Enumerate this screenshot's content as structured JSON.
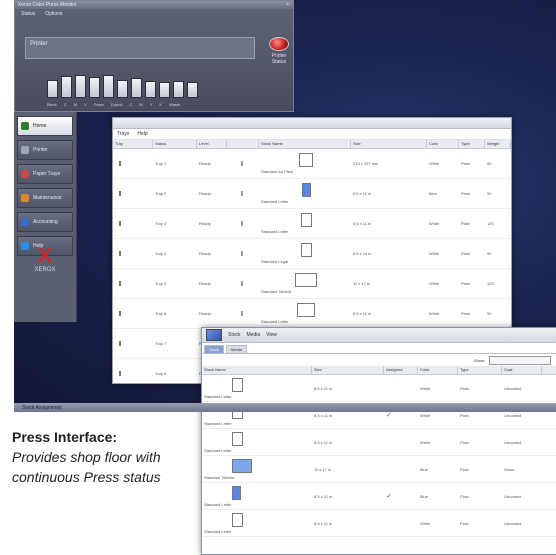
{
  "caption": {
    "title": "Press Interface:",
    "body": "Provides shop floor with continuous Press status"
  },
  "panel": {
    "title": "Xerox Color Press Monitor",
    "menu": [
      "Status",
      "Options"
    ],
    "press_name": "Printer",
    "status": "Printer Status",
    "meter_labels": [
      "Black",
      "C",
      "M",
      "Y",
      "Fuser",
      "DryInk",
      "C",
      "M",
      "Y",
      "K",
      "Waste"
    ],
    "meter_levels": [
      0.55,
      0.85,
      0.9,
      0.8,
      0.95,
      0.6,
      0.7,
      0.5,
      0.45,
      0.5,
      0.4
    ]
  },
  "nav": {
    "items": [
      {
        "label": "Home",
        "icon": "home-icon",
        "color": "#2e7d32"
      },
      {
        "label": "Printer",
        "icon": "printer-icon",
        "color": "#9aa3b8"
      },
      {
        "label": "Paper Trays",
        "icon": "paper-icon",
        "color": "#c84a4a"
      },
      {
        "label": "Maintenance",
        "icon": "wrench-icon",
        "color": "#d88a2a"
      },
      {
        "label": "Accounting",
        "icon": "chart-icon",
        "color": "#3a6bc9"
      },
      {
        "label": "Help",
        "icon": "help-icon",
        "color": "#2a8fd9"
      }
    ],
    "brand": "XEROX"
  },
  "trays_window": {
    "menu": [
      "Trays",
      "Help"
    ],
    "columns": [
      "Tray",
      "Status",
      "Level",
      "",
      "Stock Name",
      "Size",
      "Color",
      "Type",
      "Weight"
    ],
    "rows": [
      {
        "tray": "Tray 1",
        "status": "Ready",
        "level": 0.3,
        "stock": "Standard A4 Plain",
        "size": "210 x 297 mm",
        "color": "White",
        "type": "Plain",
        "weight": "90",
        "sheet_w": 12,
        "sheet_color": "#ffffff"
      },
      {
        "tray": "Tray 2",
        "status": "Ready",
        "level": 0.55,
        "stock": "Standard Letter",
        "size": "8.5 x 11 in",
        "color": "Blue",
        "type": "Plain",
        "weight": "90",
        "sheet_w": 7,
        "sheet_color": "#5b86e0"
      },
      {
        "tray": "Tray 3",
        "status": "Ready",
        "level": 0.4,
        "stock": "Standard Letter",
        "size": "8.5 x 11 in",
        "color": "White",
        "type": "Plain",
        "weight": "120",
        "sheet_w": 9,
        "sheet_color": "#ffffff"
      },
      {
        "tray": "Tray 4",
        "status": "Ready",
        "level": 0.6,
        "stock": "Standard Legal",
        "size": "8.5 x 14 in",
        "color": "White",
        "type": "Plain",
        "weight": "90",
        "sheet_w": 9,
        "sheet_color": "#ffffff"
      },
      {
        "tray": "Tray 5",
        "status": "Ready",
        "level": 0.8,
        "stock": "Standard Tabloid",
        "size": "11 x 17 in",
        "color": "White",
        "type": "Plain",
        "weight": "120",
        "sheet_w": 20,
        "sheet_color": "#ffffff"
      },
      {
        "tray": "Tray 6",
        "status": "Ready",
        "level": 0.25,
        "stock": "Standard Letter",
        "size": "8.5 x 11 in",
        "color": "White",
        "type": "Plain",
        "weight": "90",
        "sheet_w": 16,
        "sheet_color": "#ffffff"
      },
      {
        "tray": "Tray 7",
        "status": "Ready",
        "level": 0.7,
        "stock": "Standard Letter",
        "size": "8.5 x 11 in",
        "color": "Goldenrod",
        "type": "Plain",
        "weight": "90",
        "sheet_w": 8,
        "sheet_color": "#e8c82a"
      },
      {
        "tray": "Tray 8",
        "status": "Ready",
        "level": 0.45,
        "stock": "Standard Letter",
        "size": "8.5 x 11 in",
        "color": "White",
        "type": "Plain",
        "weight": "90",
        "sheet_w": 10,
        "sheet_color": "#ffffff"
      }
    ]
  },
  "stock_window": {
    "menu": [
      "Stock",
      "Media",
      "View"
    ],
    "tabs": [
      "Stock",
      "Media"
    ],
    "filter_label": "Show:",
    "columns": [
      "Stock Name",
      "Size",
      "Assigned",
      "Color",
      "Type",
      "Coat"
    ],
    "rows": [
      {
        "name": "Standard Letter",
        "size": "8.5 x 11 in",
        "assigned": "",
        "color": "White",
        "type": "Plain",
        "coat": "Uncoated",
        "sheet_w": 9,
        "sheet_color": "#ffffff"
      },
      {
        "name": "Standard Letter",
        "size": "8.5 x 11 in",
        "assigned": "✓",
        "color": "White",
        "type": "Plain",
        "coat": "Uncoated",
        "sheet_w": 9,
        "sheet_color": "#ffffff"
      },
      {
        "name": "Standard Letter",
        "size": "8.5 x 11 in",
        "assigned": "",
        "color": "White",
        "type": "Plain",
        "coat": "Uncoated",
        "sheet_w": 9,
        "sheet_color": "#ffffff"
      },
      {
        "name": "Standard Tabloid",
        "size": "11 x 17 in",
        "assigned": "",
        "color": "Blue",
        "type": "Plain",
        "coat": "Gloss",
        "sheet_w": 18,
        "sheet_color": "#7fa6ea"
      },
      {
        "name": "Standard Letter",
        "size": "8.5 x 11 in",
        "assigned": "✓",
        "color": "Blue",
        "type": "Plain",
        "coat": "Uncoated",
        "sheet_w": 7,
        "sheet_color": "#5b86e0"
      },
      {
        "name": "Standard Letter",
        "size": "8.5 x 11 in",
        "assigned": "",
        "color": "White",
        "type": "Plain",
        "coat": "Uncoated",
        "sheet_w": 9,
        "sheet_color": "#ffffff"
      }
    ]
  },
  "taskbar": {
    "label": "Stock Assignment"
  }
}
